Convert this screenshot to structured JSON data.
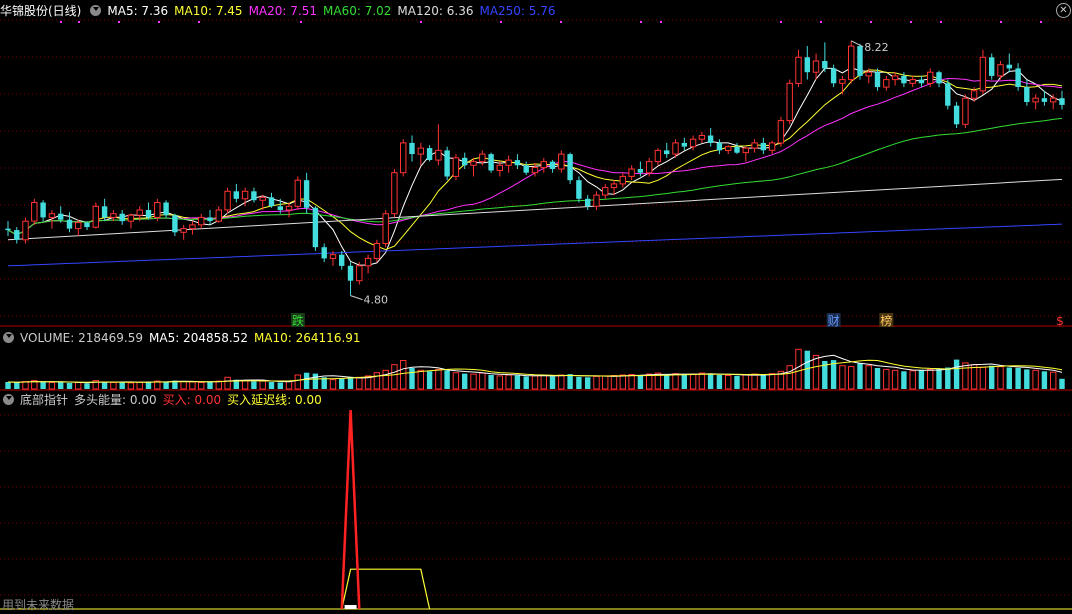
{
  "panel_main": {
    "stock_name": "华锦股份(日线)",
    "ma_labels": [
      {
        "text": "MA5: 7.36",
        "color": "#ffffff"
      },
      {
        "text": "MA10: 7.45",
        "color": "#ffff33"
      },
      {
        "text": "MA20: 7.51",
        "color": "#ff33ff"
      },
      {
        "text": "MA60: 7.02",
        "color": "#33dd33"
      },
      {
        "text": "MA120: 6.36",
        "color": "#dddddd"
      },
      {
        "text": "MA250: 5.76",
        "color": "#3344ff"
      }
    ],
    "markers": [
      {
        "text": "跌",
        "color": "#33dd33",
        "bg": "#1a3a1a"
      },
      {
        "text": "财",
        "color": "#6699ff",
        "bg": "#1a2a4a"
      },
      {
        "text": "榜",
        "color": "#ffcc66",
        "bg": "#4a3310"
      },
      {
        "text": "$",
        "color": "#ff3333",
        "bg": ""
      }
    ]
  },
  "panel_volume": {
    "labels": [
      {
        "text": "VOLUME: 218469.59",
        "color": "#cccccc"
      },
      {
        "text": "MA5: 204858.52",
        "color": "#ffffff"
      },
      {
        "text": "MA10: 264116.91",
        "color": "#ffff33"
      }
    ]
  },
  "panel_indicator": {
    "name": "底部指针",
    "labels": [
      {
        "text": "多头能量: 0.00",
        "color": "#cccccc"
      },
      {
        "text": "买入: 0.00",
        "color": "#ff3333"
      },
      {
        "text": "买入延迟线: 0.00",
        "color": "#ffff33"
      }
    ],
    "footer": "用到未来数据"
  },
  "colors": {
    "up": "#ff3333",
    "down": "#44dddd",
    "grid": "#7a0000",
    "bg": "#000000"
  },
  "chart_data": [
    {
      "type": "candlestick",
      "price_labels": {
        "high": "8.22",
        "low": "4.80"
      },
      "ylim": [
        4.5,
        8.5
      ],
      "ohlc": [
        [
          5.7,
          5.8,
          5.6,
          5.68
        ],
        [
          5.68,
          5.72,
          5.5,
          5.55
        ],
        [
          5.55,
          5.85,
          5.5,
          5.8
        ],
        [
          5.8,
          6.1,
          5.75,
          6.05
        ],
        [
          6.05,
          6.08,
          5.8,
          5.85
        ],
        [
          5.85,
          5.95,
          5.7,
          5.9
        ],
        [
          5.9,
          6.0,
          5.78,
          5.82
        ],
        [
          5.82,
          5.92,
          5.65,
          5.7
        ],
        [
          5.7,
          5.82,
          5.6,
          5.78
        ],
        [
          5.78,
          5.8,
          5.68,
          5.72
        ],
        [
          5.72,
          6.05,
          5.7,
          6.0
        ],
        [
          6.0,
          6.1,
          5.8,
          5.85
        ],
        [
          5.85,
          5.95,
          5.8,
          5.9
        ],
        [
          5.9,
          5.95,
          5.75,
          5.8
        ],
        [
          5.8,
          5.9,
          5.7,
          5.88
        ],
        [
          5.88,
          6.0,
          5.8,
          5.95
        ],
        [
          5.95,
          6.05,
          5.82,
          5.85
        ],
        [
          5.85,
          6.1,
          5.8,
          6.05
        ],
        [
          6.05,
          6.08,
          5.85,
          5.88
        ],
        [
          5.88,
          5.9,
          5.6,
          5.65
        ],
        [
          5.65,
          5.75,
          5.55,
          5.7
        ],
        [
          5.7,
          5.8,
          5.62,
          5.75
        ],
        [
          5.75,
          5.9,
          5.7,
          5.85
        ],
        [
          5.85,
          5.95,
          5.75,
          5.8
        ],
        [
          5.8,
          6.0,
          5.78,
          5.95
        ],
        [
          5.95,
          6.25,
          5.9,
          6.2
        ],
        [
          6.2,
          6.3,
          6.05,
          6.1
        ],
        [
          6.1,
          6.25,
          6.0,
          6.2
        ],
        [
          6.2,
          6.25,
          6.05,
          6.08
        ],
        [
          6.08,
          6.15,
          5.95,
          6.12
        ],
        [
          6.12,
          6.18,
          5.98,
          6.0
        ],
        [
          6.0,
          6.1,
          5.9,
          5.95
        ],
        [
          5.95,
          6.05,
          5.85,
          6.0
        ],
        [
          6.0,
          6.4,
          5.95,
          6.35
        ],
        [
          6.35,
          6.45,
          5.9,
          5.98
        ],
        [
          5.98,
          6.0,
          5.4,
          5.45
        ],
        [
          5.45,
          5.5,
          5.25,
          5.3
        ],
        [
          5.3,
          5.4,
          5.2,
          5.35
        ],
        [
          5.35,
          5.4,
          5.15,
          5.2
        ],
        [
          5.2,
          5.25,
          4.8,
          5.0
        ],
        [
          5.0,
          5.25,
          4.95,
          5.2
        ],
        [
          5.2,
          5.35,
          5.1,
          5.3
        ],
        [
          5.3,
          5.55,
          5.25,
          5.5
        ],
        [
          5.5,
          5.95,
          5.45,
          5.9
        ],
        [
          5.9,
          6.5,
          5.85,
          6.45
        ],
        [
          6.45,
          6.9,
          6.4,
          6.85
        ],
        [
          6.85,
          6.95,
          6.6,
          6.7
        ],
        [
          6.7,
          6.85,
          6.55,
          6.78
        ],
        [
          6.78,
          6.82,
          6.6,
          6.62
        ],
        [
          6.62,
          7.1,
          6.55,
          6.75
        ],
        [
          6.75,
          6.8,
          6.35,
          6.4
        ],
        [
          6.4,
          6.7,
          6.35,
          6.65
        ],
        [
          6.65,
          6.72,
          6.5,
          6.55
        ],
        [
          6.55,
          6.65,
          6.4,
          6.6
        ],
        [
          6.6,
          6.75,
          6.55,
          6.7
        ],
        [
          6.7,
          6.72,
          6.45,
          6.48
        ],
        [
          6.48,
          6.6,
          6.4,
          6.55
        ],
        [
          6.55,
          6.68,
          6.45,
          6.62
        ],
        [
          6.62,
          6.7,
          6.5,
          6.55
        ],
        [
          6.55,
          6.6,
          6.42,
          6.45
        ],
        [
          6.45,
          6.58,
          6.4,
          6.52
        ],
        [
          6.52,
          6.65,
          6.45,
          6.6
        ],
        [
          6.6,
          6.62,
          6.45,
          6.5
        ],
        [
          6.5,
          6.75,
          6.45,
          6.7
        ],
        [
          6.7,
          6.72,
          6.3,
          6.35
        ],
        [
          6.35,
          6.4,
          6.05,
          6.1
        ],
        [
          6.1,
          6.15,
          5.95,
          6.0
        ],
        [
          6.0,
          6.2,
          5.95,
          6.15
        ],
        [
          6.15,
          6.3,
          6.1,
          6.25
        ],
        [
          6.25,
          6.35,
          6.15,
          6.3
        ],
        [
          6.3,
          6.45,
          6.25,
          6.4
        ],
        [
          6.4,
          6.55,
          6.35,
          6.5
        ],
        [
          6.5,
          6.6,
          6.4,
          6.45
        ],
        [
          6.45,
          6.65,
          6.4,
          6.6
        ],
        [
          6.6,
          6.78,
          6.55,
          6.75
        ],
        [
          6.75,
          6.85,
          6.65,
          6.7
        ],
        [
          6.7,
          6.9,
          6.65,
          6.85
        ],
        [
          6.85,
          6.92,
          6.75,
          6.8
        ],
        [
          6.8,
          6.95,
          6.75,
          6.9
        ],
        [
          6.9,
          7.0,
          6.85,
          6.95
        ],
        [
          6.95,
          7.05,
          6.8,
          6.85
        ],
        [
          6.85,
          6.9,
          6.7,
          6.75
        ],
        [
          6.75,
          6.82,
          6.7,
          6.8
        ],
        [
          6.8,
          6.85,
          6.7,
          6.72
        ],
        [
          6.72,
          6.8,
          6.6,
          6.78
        ],
        [
          6.78,
          6.9,
          6.72,
          6.85
        ],
        [
          6.85,
          6.92,
          6.7,
          6.75
        ],
        [
          6.75,
          6.88,
          6.7,
          6.85
        ],
        [
          6.85,
          7.2,
          6.8,
          7.15
        ],
        [
          7.15,
          7.7,
          7.1,
          7.65
        ],
        [
          7.65,
          8.1,
          7.6,
          8.0
        ],
        [
          8.0,
          8.15,
          7.7,
          7.8
        ],
        [
          7.8,
          8.05,
          7.7,
          7.95
        ],
        [
          7.95,
          8.2,
          7.8,
          7.85
        ],
        [
          7.85,
          7.9,
          7.6,
          7.65
        ],
        [
          7.65,
          7.75,
          7.5,
          7.7
        ],
        [
          7.7,
          8.22,
          7.65,
          8.15
        ],
        [
          8.15,
          8.18,
          7.7,
          7.75
        ],
        [
          7.75,
          7.85,
          7.65,
          7.8
        ],
        [
          7.8,
          7.85,
          7.55,
          7.6
        ],
        [
          7.6,
          7.75,
          7.55,
          7.7
        ],
        [
          7.7,
          7.8,
          7.62,
          7.75
        ],
        [
          7.75,
          7.8,
          7.6,
          7.65
        ],
        [
          7.65,
          7.75,
          7.6,
          7.7
        ],
        [
          7.7,
          7.75,
          7.6,
          7.65
        ],
        [
          7.65,
          7.85,
          7.6,
          7.8
        ],
        [
          7.8,
          7.82,
          7.6,
          7.65
        ],
        [
          7.65,
          7.7,
          7.3,
          7.35
        ],
        [
          7.35,
          7.4,
          7.05,
          7.1
        ],
        [
          7.1,
          7.5,
          7.05,
          7.45
        ],
        [
          7.45,
          7.6,
          7.4,
          7.55
        ],
        [
          7.55,
          8.1,
          7.5,
          8.0
        ],
        [
          8.0,
          8.05,
          7.7,
          7.75
        ],
        [
          7.75,
          7.95,
          7.7,
          7.9
        ],
        [
          7.9,
          8.05,
          7.8,
          7.85
        ],
        [
          7.85,
          7.92,
          7.55,
          7.6
        ],
        [
          7.6,
          7.7,
          7.35,
          7.4
        ],
        [
          7.4,
          7.5,
          7.3,
          7.45
        ],
        [
          7.45,
          7.55,
          7.35,
          7.4
        ],
        [
          7.4,
          7.5,
          7.3,
          7.45
        ],
        [
          7.45,
          7.55,
          7.3,
          7.36
        ]
      ]
    },
    {
      "type": "bar",
      "series_label": "VOLUME",
      "ylim": [
        0,
        900000
      ],
      "values": [
        150000,
        140000,
        160000,
        180000,
        150000,
        140000,
        150000,
        130000,
        140000,
        120000,
        180000,
        160000,
        140000,
        150000,
        130000,
        150000,
        160000,
        170000,
        150000,
        180000,
        160000,
        150000,
        140000,
        150000,
        170000,
        250000,
        200000,
        180000,
        160000,
        170000,
        150000,
        140000,
        160000,
        300000,
        350000,
        330000,
        250000,
        200000,
        220000,
        260000,
        250000,
        280000,
        350000,
        400000,
        520000,
        610000,
        450000,
        400000,
        380000,
        420000,
        400000,
        350000,
        330000,
        320000,
        340000,
        300000,
        280000,
        300000,
        290000,
        270000,
        280000,
        290000,
        270000,
        300000,
        320000,
        260000,
        250000,
        270000,
        280000,
        290000,
        300000,
        310000,
        290000,
        320000,
        340000,
        300000,
        330000,
        310000,
        320000,
        340000,
        330000,
        300000,
        290000,
        280000,
        300000,
        320000,
        310000,
        330000,
        380000,
        500000,
        850000,
        820000,
        720000,
        600000,
        620000,
        500000,
        480000,
        560000,
        500000,
        450000,
        420000,
        400000,
        380000,
        390000,
        410000,
        420000,
        440000,
        460000,
        630000,
        560000,
        520000,
        470000,
        500000,
        480000,
        460000,
        450000,
        420000,
        400000,
        380000,
        360000,
        218469
      ],
      "ma5": 204858.52,
      "ma10": 264116.91
    },
    {
      "type": "line",
      "series_label": "底部指针",
      "ylim": [
        0,
        100
      ],
      "spike": {
        "index": 39,
        "peak": 100
      },
      "plateau": {
        "start": 38,
        "end": 48,
        "level": 20
      }
    }
  ]
}
